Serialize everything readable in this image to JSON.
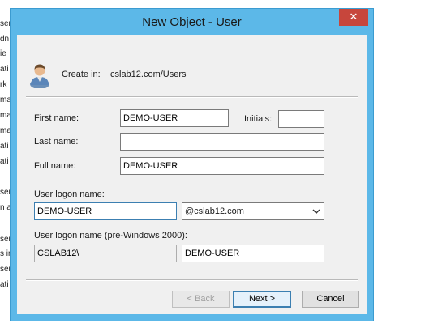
{
  "background_window": {
    "fragments": [
      "ser",
      "dn",
      "ie",
      "ati",
      "rk",
      "ma",
      "ma",
      "ma",
      "ati",
      "ati",
      "ser",
      "n a",
      "ser",
      "s in",
      "ser",
      "ati"
    ]
  },
  "dialog": {
    "title": "New Object - User",
    "close_glyph": "✕",
    "create_in_label": "Create in:",
    "create_in_path": "cslab12.com/Users"
  },
  "form": {
    "first_name_label": "First name:",
    "first_name_value": "DEMO-USER",
    "initials_label": "Initials:",
    "initials_value": "",
    "last_name_label": "Last name:",
    "last_name_value": "",
    "full_name_label": "Full name:",
    "full_name_value": "DEMO-USER",
    "logon_name_label": "User logon name:",
    "logon_name_value": "DEMO-USER",
    "domain_suffix_value": "@cslab12.com",
    "pre2000_label": "User logon name (pre-Windows 2000):",
    "pre2000_domain_value": "CSLAB12\\",
    "pre2000_name_value": "DEMO-USER"
  },
  "buttons": {
    "back_label": "< Back",
    "next_label": "Next >",
    "cancel_label": "Cancel"
  },
  "colors": {
    "title_bar": "#5cb8e8",
    "close_button": "#c7463c",
    "client_background": "#f0f0f0",
    "focus_border": "#3c7fb1"
  },
  "icons": {
    "user": "user-icon",
    "close": "close-icon",
    "dropdown": "chevron-down-icon"
  }
}
